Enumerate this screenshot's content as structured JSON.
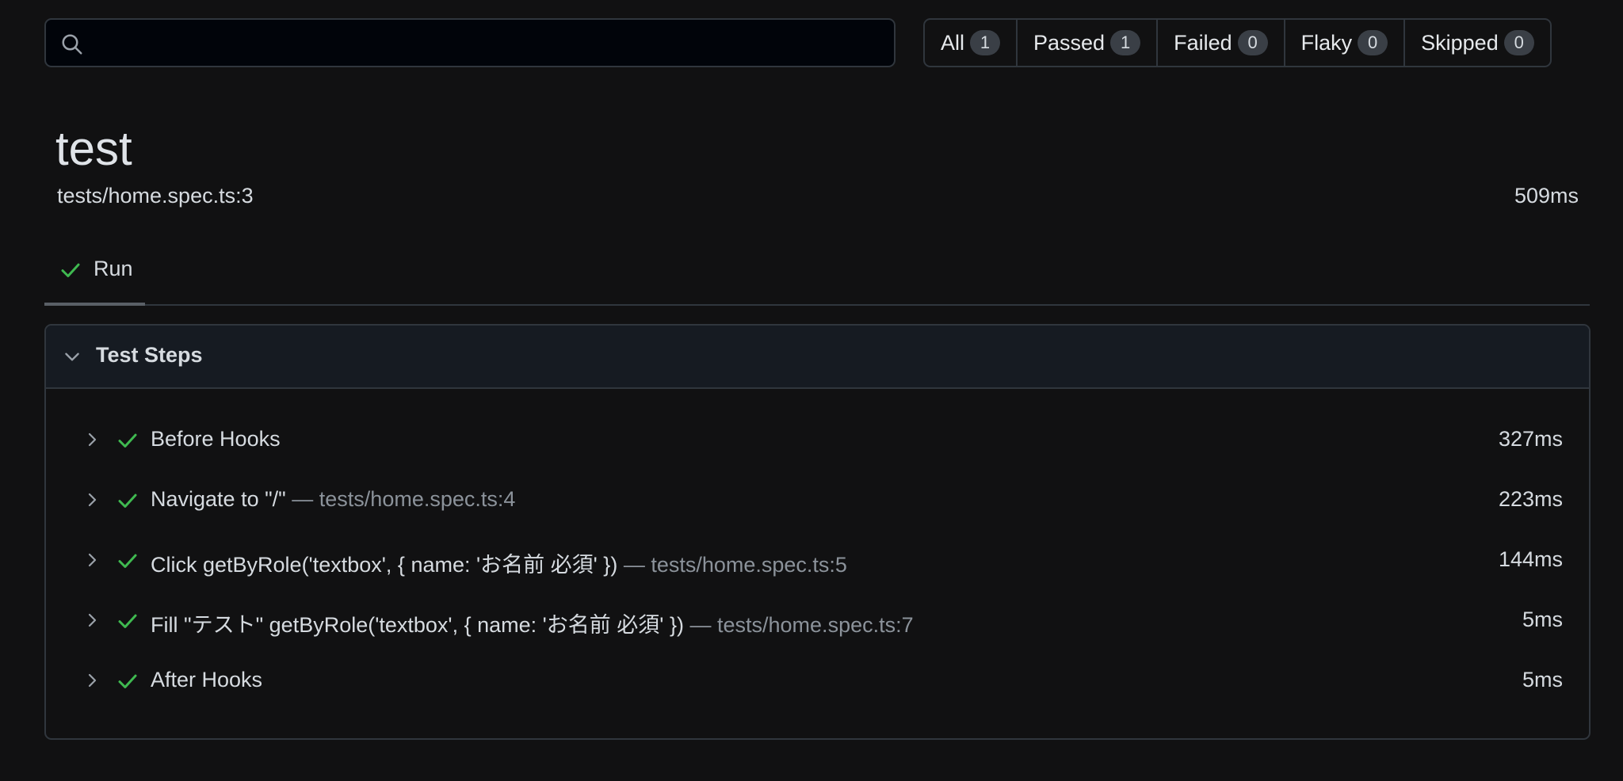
{
  "search": {
    "placeholder": "",
    "value": ""
  },
  "filters": [
    {
      "label": "All",
      "count": "1"
    },
    {
      "label": "Passed",
      "count": "1"
    },
    {
      "label": "Failed",
      "count": "0"
    },
    {
      "label": "Flaky",
      "count": "0"
    },
    {
      "label": "Skipped",
      "count": "0"
    }
  ],
  "test": {
    "title": "test",
    "file": "tests/home.spec.ts:3",
    "duration": "509ms"
  },
  "tabs": [
    {
      "label": "Run",
      "status": "passed"
    }
  ],
  "panel": {
    "title": "Test Steps",
    "steps": [
      {
        "text": "Before Hooks",
        "location": "",
        "duration": "327ms"
      },
      {
        "text": "Navigate to \"/\"",
        "location": "— tests/home.spec.ts:4",
        "duration": "223ms"
      },
      {
        "text": "Click getByRole('textbox', { name: 'お名前 必須' })",
        "location": "— tests/home.spec.ts:5",
        "duration": "144ms"
      },
      {
        "text": "Fill \"テスト\" getByRole('textbox', { name: 'お名前 必須' })",
        "location": "— tests/home.spec.ts:7",
        "duration": "5ms"
      },
      {
        "text": "After Hooks",
        "location": "",
        "duration": "5ms"
      }
    ]
  },
  "colors": {
    "background": "#111112",
    "border": "#30363d",
    "success": "#3fb950",
    "muted": "#8b929a"
  },
  "icons": {
    "search": "search-icon",
    "check": "check-icon",
    "chevron_down": "chevron-down-icon",
    "chevron_right": "chevron-right-icon"
  }
}
